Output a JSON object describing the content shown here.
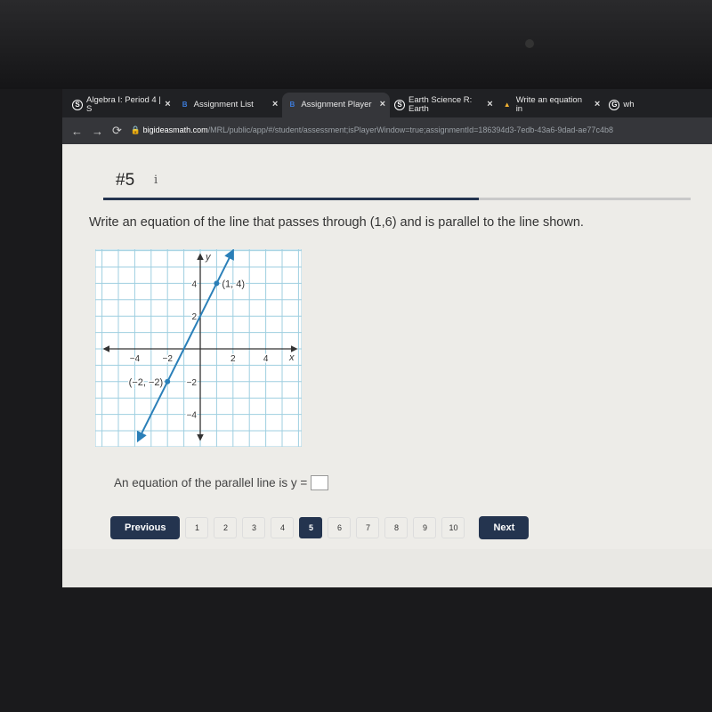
{
  "browser": {
    "tabs": [
      {
        "label": "Algebra I: Period 4 | S",
        "icon": "schoology-icon",
        "color": "#ffffff"
      },
      {
        "label": "Assignment List",
        "icon": "bigideas-icon",
        "color": "#3d7bd9"
      },
      {
        "label": "Assignment Player",
        "icon": "bigideas-icon",
        "color": "#3d7bd9",
        "active": true
      },
      {
        "label": "Earth Science R: Earth",
        "icon": "schoology-icon",
        "color": "#ffffff"
      },
      {
        "label": "Write an equation in",
        "icon": "brainly-icon",
        "color": "#f2b233"
      },
      {
        "label": "wh",
        "icon": "google-icon",
        "color": "#ffffff"
      }
    ],
    "close_glyph": "×",
    "url_domain": "bigideasmath.com",
    "url_path": "/MRL/public/app/#/student/assessment;isPlayerWindow=true;assignmentId=186394d3-7edb-43a6-9dad-ae77c4b8"
  },
  "question": {
    "number": "#5",
    "info": "i",
    "prompt": "Write an equation of the line that passes through (1,6) and is parallel to the line shown.",
    "answer_label": "An equation of the parallel line is y =",
    "answer_value": "",
    "progress_percent": 64
  },
  "graph": {
    "x_label": "x",
    "y_label": "y",
    "x_ticks": [
      {
        "v": -4,
        "t": "−4"
      },
      {
        "v": -2,
        "t": "−2"
      },
      {
        "v": 2,
        "t": "2"
      },
      {
        "v": 4,
        "t": "4"
      }
    ],
    "y_ticks": [
      {
        "v": 4,
        "t": "4"
      },
      {
        "v": 2,
        "t": "2"
      },
      {
        "v": -2,
        "t": "−2"
      },
      {
        "v": -4,
        "t": "−4"
      }
    ],
    "points": [
      {
        "x": 1,
        "y": 4,
        "label": "(1, 4)"
      },
      {
        "x": -2,
        "y": -2,
        "label": "(−2, −2)"
      }
    ],
    "line_color": "#2a7fb8",
    "grid_color": "#9fcfe0"
  },
  "pager": {
    "previous": "Previous",
    "next": "Next",
    "pages": [
      "1",
      "2",
      "3",
      "4",
      "5",
      "6",
      "7",
      "8",
      "9",
      "10"
    ],
    "current": "5"
  },
  "taskbar": {
    "icons": [
      {
        "name": "windows-start-icon",
        "color": "#1b74d8"
      },
      {
        "name": "search-icon",
        "color": "#333333"
      },
      {
        "name": "task-view-icon",
        "color": "#222222"
      },
      {
        "name": "chrome-icon",
        "color": "#e8a020"
      },
      {
        "name": "edge-icon",
        "color": "#1a9bd7"
      },
      {
        "name": "file-explorer-icon",
        "color": "#f2c230"
      },
      {
        "name": "store-icon",
        "color": "#2a5aa0"
      },
      {
        "name": "pinterest-icon",
        "color": "#d0223a"
      },
      {
        "name": "spotify-icon",
        "color": "#1db954"
      },
      {
        "name": "onenote-icon",
        "color": "#7b3fb0"
      },
      {
        "name": "word-icon",
        "color": "#2b62c0"
      }
    ]
  }
}
